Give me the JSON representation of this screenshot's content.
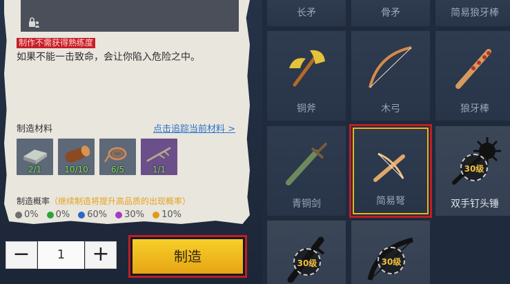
{
  "item_detail": {
    "red_label": "制作不需获得熟练度",
    "description": "如果不能一击致命，会让你陷入危险之中。"
  },
  "materials": {
    "label": "制造材料",
    "track_link": "点击追踪当前材料 >",
    "items": [
      {
        "icon": "iron-ingot-icon",
        "count": "2/1"
      },
      {
        "icon": "wood-log-icon",
        "count": "10/10"
      },
      {
        "icon": "rope-icon",
        "count": "6/5"
      },
      {
        "icon": "branch-icon",
        "count": "1/1"
      }
    ]
  },
  "rates": {
    "label": "制造概率",
    "hint": "（继续制造将提升高品质的出现概率）",
    "items": [
      {
        "color": "#6e6e6e",
        "value": "0%"
      },
      {
        "color": "#2ea33a",
        "value": "0%"
      },
      {
        "color": "#2d68c4",
        "value": "60%"
      },
      {
        "color": "#a33cc4",
        "value": "30%"
      },
      {
        "color": "#e29a17",
        "value": "10%"
      }
    ]
  },
  "quantity": {
    "value": "1",
    "minus": "−",
    "plus": "+"
  },
  "craft_button": "制造",
  "grid": [
    {
      "name": "长矛",
      "icon": "spear-icon"
    },
    {
      "name": "骨矛",
      "icon": "bone-spear-icon"
    },
    {
      "name": "简易狼牙棒",
      "icon": "simple-mace-icon"
    },
    {
      "name": "铜斧",
      "icon": "copper-axe-icon"
    },
    {
      "name": "木弓",
      "icon": "wooden-bow-icon"
    },
    {
      "name": "狼牙棒",
      "icon": "mace-icon"
    },
    {
      "name": "青铜剑",
      "icon": "bronze-sword-icon"
    },
    {
      "name": "简易弩",
      "icon": "crossbow-icon",
      "selected": true
    },
    {
      "name": "双手钉头锤",
      "icon": "two-hand-flail-icon",
      "level": "30级"
    },
    {
      "name": "",
      "icon": "blade-icon",
      "level": "30级"
    },
    {
      "name": "",
      "icon": "bow-icon",
      "level": "30级"
    }
  ]
}
